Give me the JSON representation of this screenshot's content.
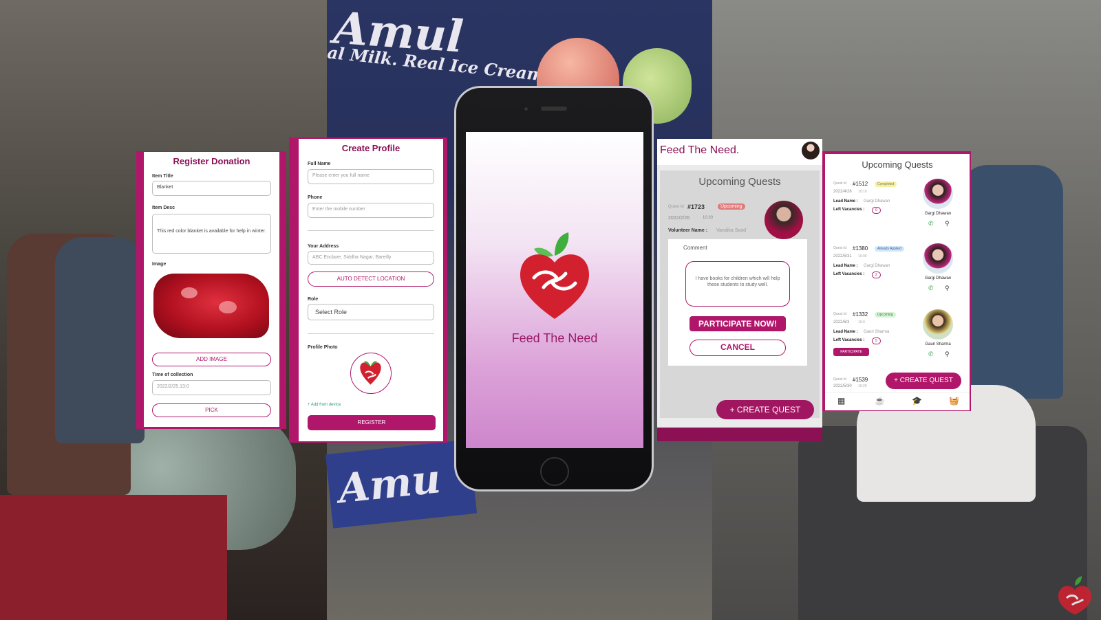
{
  "background": {
    "amul_top": "Amul",
    "amul_sub": "al Milk. Real Ice Cream",
    "amul_bottom": "Amu"
  },
  "register_donation": {
    "title": "Register Donation",
    "item_title_label": "Item Title",
    "item_title_value": "Blanket",
    "item_desc_label": "Item Desc",
    "item_desc_value": "This red color blanket is available for help in winter.",
    "image_label": "Image",
    "add_image_label": "ADD IMAGE",
    "time_label": "Time of collection",
    "time_value": "2022/2/25,13:0",
    "pick_label": "PICK"
  },
  "create_profile": {
    "title": "Create Profile",
    "full_name_label": "Full Name",
    "full_name_placeholder": "Please enter you full name",
    "phone_label": "Phone",
    "phone_placeholder": "Enter the mobile number",
    "address_label": "Your Address",
    "address_placeholder": "ABC Enclave, Siddha Nagar, Bareilly",
    "auto_detect_label": "AUTO DETECT LOCATION",
    "role_label": "Role",
    "role_value": "Select Role",
    "profile_photo_label": "Profile Photo",
    "add_from_device": "+ Add from device",
    "register_label": "REGISTER"
  },
  "phone": {
    "app_name": "Feed The Need"
  },
  "quest_comment": {
    "app_title": "Feed The Need.",
    "heading": "Upcoming Quests",
    "quest_id_label": "Quest Id",
    "quest_id": "#1723",
    "status": "Upcoming",
    "date": "2022/2/26",
    "time": "10:30",
    "volunteer_label": "Volunteer Name :",
    "volunteer_name": "Vandika Sood",
    "comment_label": "Comment",
    "comment_text": "I have books for children which will help these students to study well.",
    "participate_label": "PARTICIPATE NOW!",
    "cancel_label": "CANCEL",
    "create_quest_label": "+ CREATE QUEST"
  },
  "quest_list": {
    "heading": "Upcoming Quests",
    "quests": [
      {
        "quest_id_label": "Quest Id",
        "quest_id": "#1512",
        "status": "Completed",
        "date": "2022/4/28",
        "time": "10:10",
        "lead_label": "Lead Name :",
        "lead_name": "Gargi Dhawan",
        "vacancies_label": "Left Vacancies :",
        "vacancies": "0",
        "avatar_name": "Gargi Dhawan"
      },
      {
        "quest_id_label": "Quest Id",
        "quest_id": "#1380",
        "status": "Already Applied",
        "date": "2022/5/31",
        "time": "10:00",
        "lead_label": "Lead Name :",
        "lead_name": "Gargi Dhawan",
        "vacancies_label": "Left Vacancies :",
        "vacancies": "2",
        "avatar_name": "Gargi Dhawan"
      },
      {
        "quest_id_label": "Quest Id",
        "quest_id": "#1332",
        "status": "Upcoming",
        "date": "2022/6/3",
        "time": "10:0",
        "lead_label": "Lead Name :",
        "lead_name": "Gauri Sharma",
        "vacancies_label": "Left Vacancies :",
        "vacancies": "5",
        "avatar_name": "Gauri Sharma",
        "participate_label": "PARTICIPATE"
      },
      {
        "quest_id_label": "Quest Id",
        "quest_id": "#1539",
        "date": "2022/5/30",
        "time": "10:20"
      }
    ],
    "create_quest_label": "+ CREATE QUEST",
    "nav_icons": [
      "dashboard-icon",
      "cup-icon",
      "graduation-cap-icon",
      "basket-icon"
    ]
  },
  "colors": {
    "brand": "#b0176b",
    "brand_dark": "#8b1054",
    "leaf_green": "#3fae3c",
    "heart_red": "#d3202f"
  }
}
